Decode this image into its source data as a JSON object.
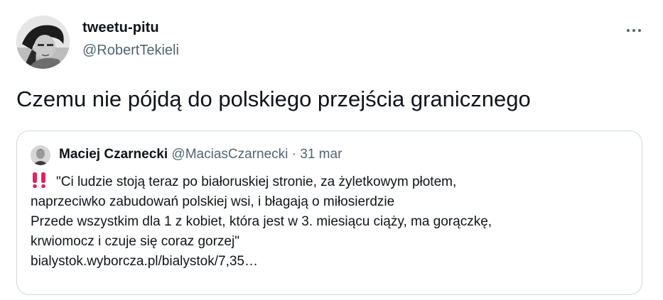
{
  "tweet": {
    "author": {
      "display_name": "tweetu-pitu",
      "handle": "@RobertTekieli"
    },
    "text": "Czemu nie pójdą do polskiego przejścia granicznego",
    "more_icon": "more-horizontal-icon"
  },
  "quoted_tweet": {
    "author": {
      "display_name": "Maciej Czarnecki",
      "handle": "@MaciasCzarnecki"
    },
    "separator": "·",
    "date": "31 mar",
    "lead_icon": "double-exclamation-icon",
    "lines": [
      "\"Ci ludzie stoją teraz po białoruskiej stronie, za żyletkowym płotem,",
      "naprzeciwko zabudowań polskiej wsi, i błagają o miłosierdzie",
      "Przede wszystkim dla 1 z kobiet, która jest w 3. miesiącu ciąży, ma gorączkę,",
      "krwiomocz i czuje się coraz gorzej\"",
      "bialystok.wyborcza.pl/bialystok/7,35…"
    ]
  },
  "colors": {
    "text_primary": "#0f1419",
    "text_secondary": "#536471",
    "border": "#cfd9de",
    "emoji_red": "#e0245e"
  }
}
